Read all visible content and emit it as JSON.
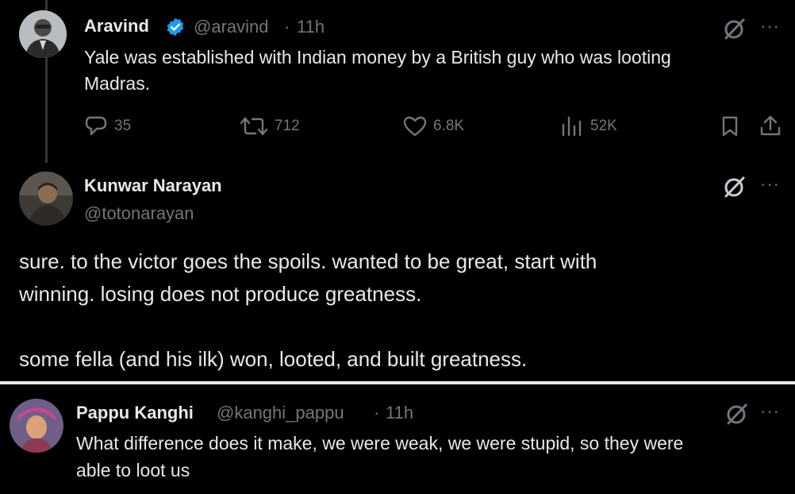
{
  "tweet1": {
    "name": "Aravind",
    "verified": true,
    "handle": "@aravind",
    "sep": "·",
    "time": "11h",
    "text_line1": "Yale was established with Indian money by a British guy who was looting",
    "text_line2": "Madras.",
    "actions": {
      "replies": "35",
      "retweets": "712",
      "likes": "6.8K",
      "views": "52K"
    },
    "more_label": "···"
  },
  "tweet2": {
    "name": "Kunwar Narayan",
    "handle": "@totonarayan",
    "line1": "sure.  to the victor goes the spoils.  wanted to be great, start with",
    "line2": "winning.  losing does not produce greatness.",
    "line3": "some fella (and his ilk) won, looted, and built greatness.",
    "more_label": "···"
  },
  "tweet3": {
    "name": "Pappu Kanghi",
    "handle": "@kanghi_pappu",
    "sep": "·",
    "time": "11h",
    "line1": "What difference does it make, we were weak, we were stupid, so they were",
    "line2": "able to loot us",
    "more_label": "···"
  },
  "colors": {
    "background": "#000000",
    "text": "#e7e9ea",
    "muted": "#71767b",
    "verified": "#1d9bf0"
  }
}
